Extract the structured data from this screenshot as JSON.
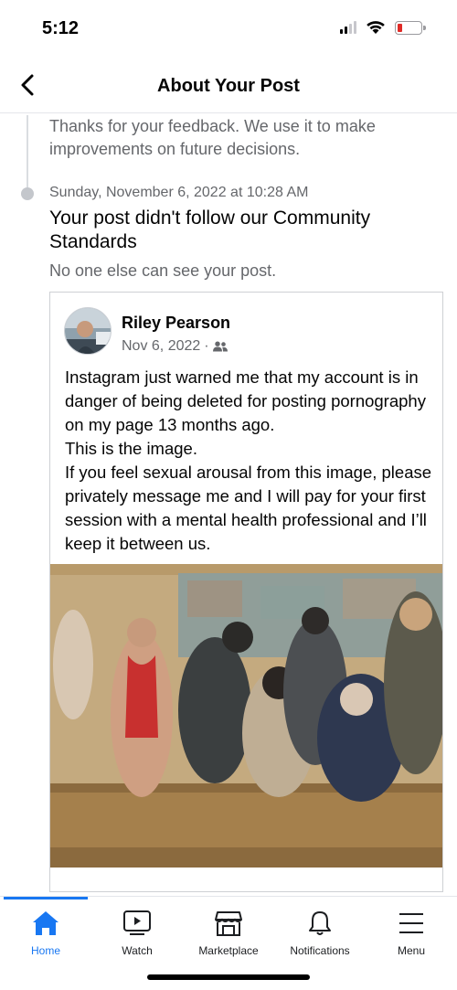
{
  "status_bar": {
    "time": "5:12"
  },
  "header": {
    "title": "About Your Post"
  },
  "timeline": {
    "feedback_text": "Thanks for your feedback. We use it to make improvements on future decisions.",
    "timestamp": "Sunday, November 6, 2022 at 10:28 AM",
    "violation_title": "Your post didn't follow our Community Standards",
    "visibility_note": "No one else can see your post."
  },
  "post": {
    "author": "Riley Pearson",
    "date": "Nov 6, 2022",
    "separator": "·",
    "audience_icon": "friends-icon",
    "text": "Instagram just warned me that my account is in danger of being deleted for posting pornography on my page 13 months ago.\nThis is the image.\nIf you feel sexual arousal from this image, please privately message me and I will pay for your first session with a mental health professional and I’ll keep it between us."
  },
  "bottom_nav": {
    "items": [
      {
        "label": "Home",
        "icon": "home-icon",
        "active": true
      },
      {
        "label": "Watch",
        "icon": "watch-icon",
        "active": false
      },
      {
        "label": "Marketplace",
        "icon": "marketplace-icon",
        "active": false
      },
      {
        "label": "Notifications",
        "icon": "bell-icon",
        "active": false
      },
      {
        "label": "Menu",
        "icon": "menu-icon",
        "active": false
      }
    ]
  },
  "colors": {
    "accent": "#1877f2",
    "secondary_text": "#65676b",
    "battery_low": "#e02b27"
  }
}
